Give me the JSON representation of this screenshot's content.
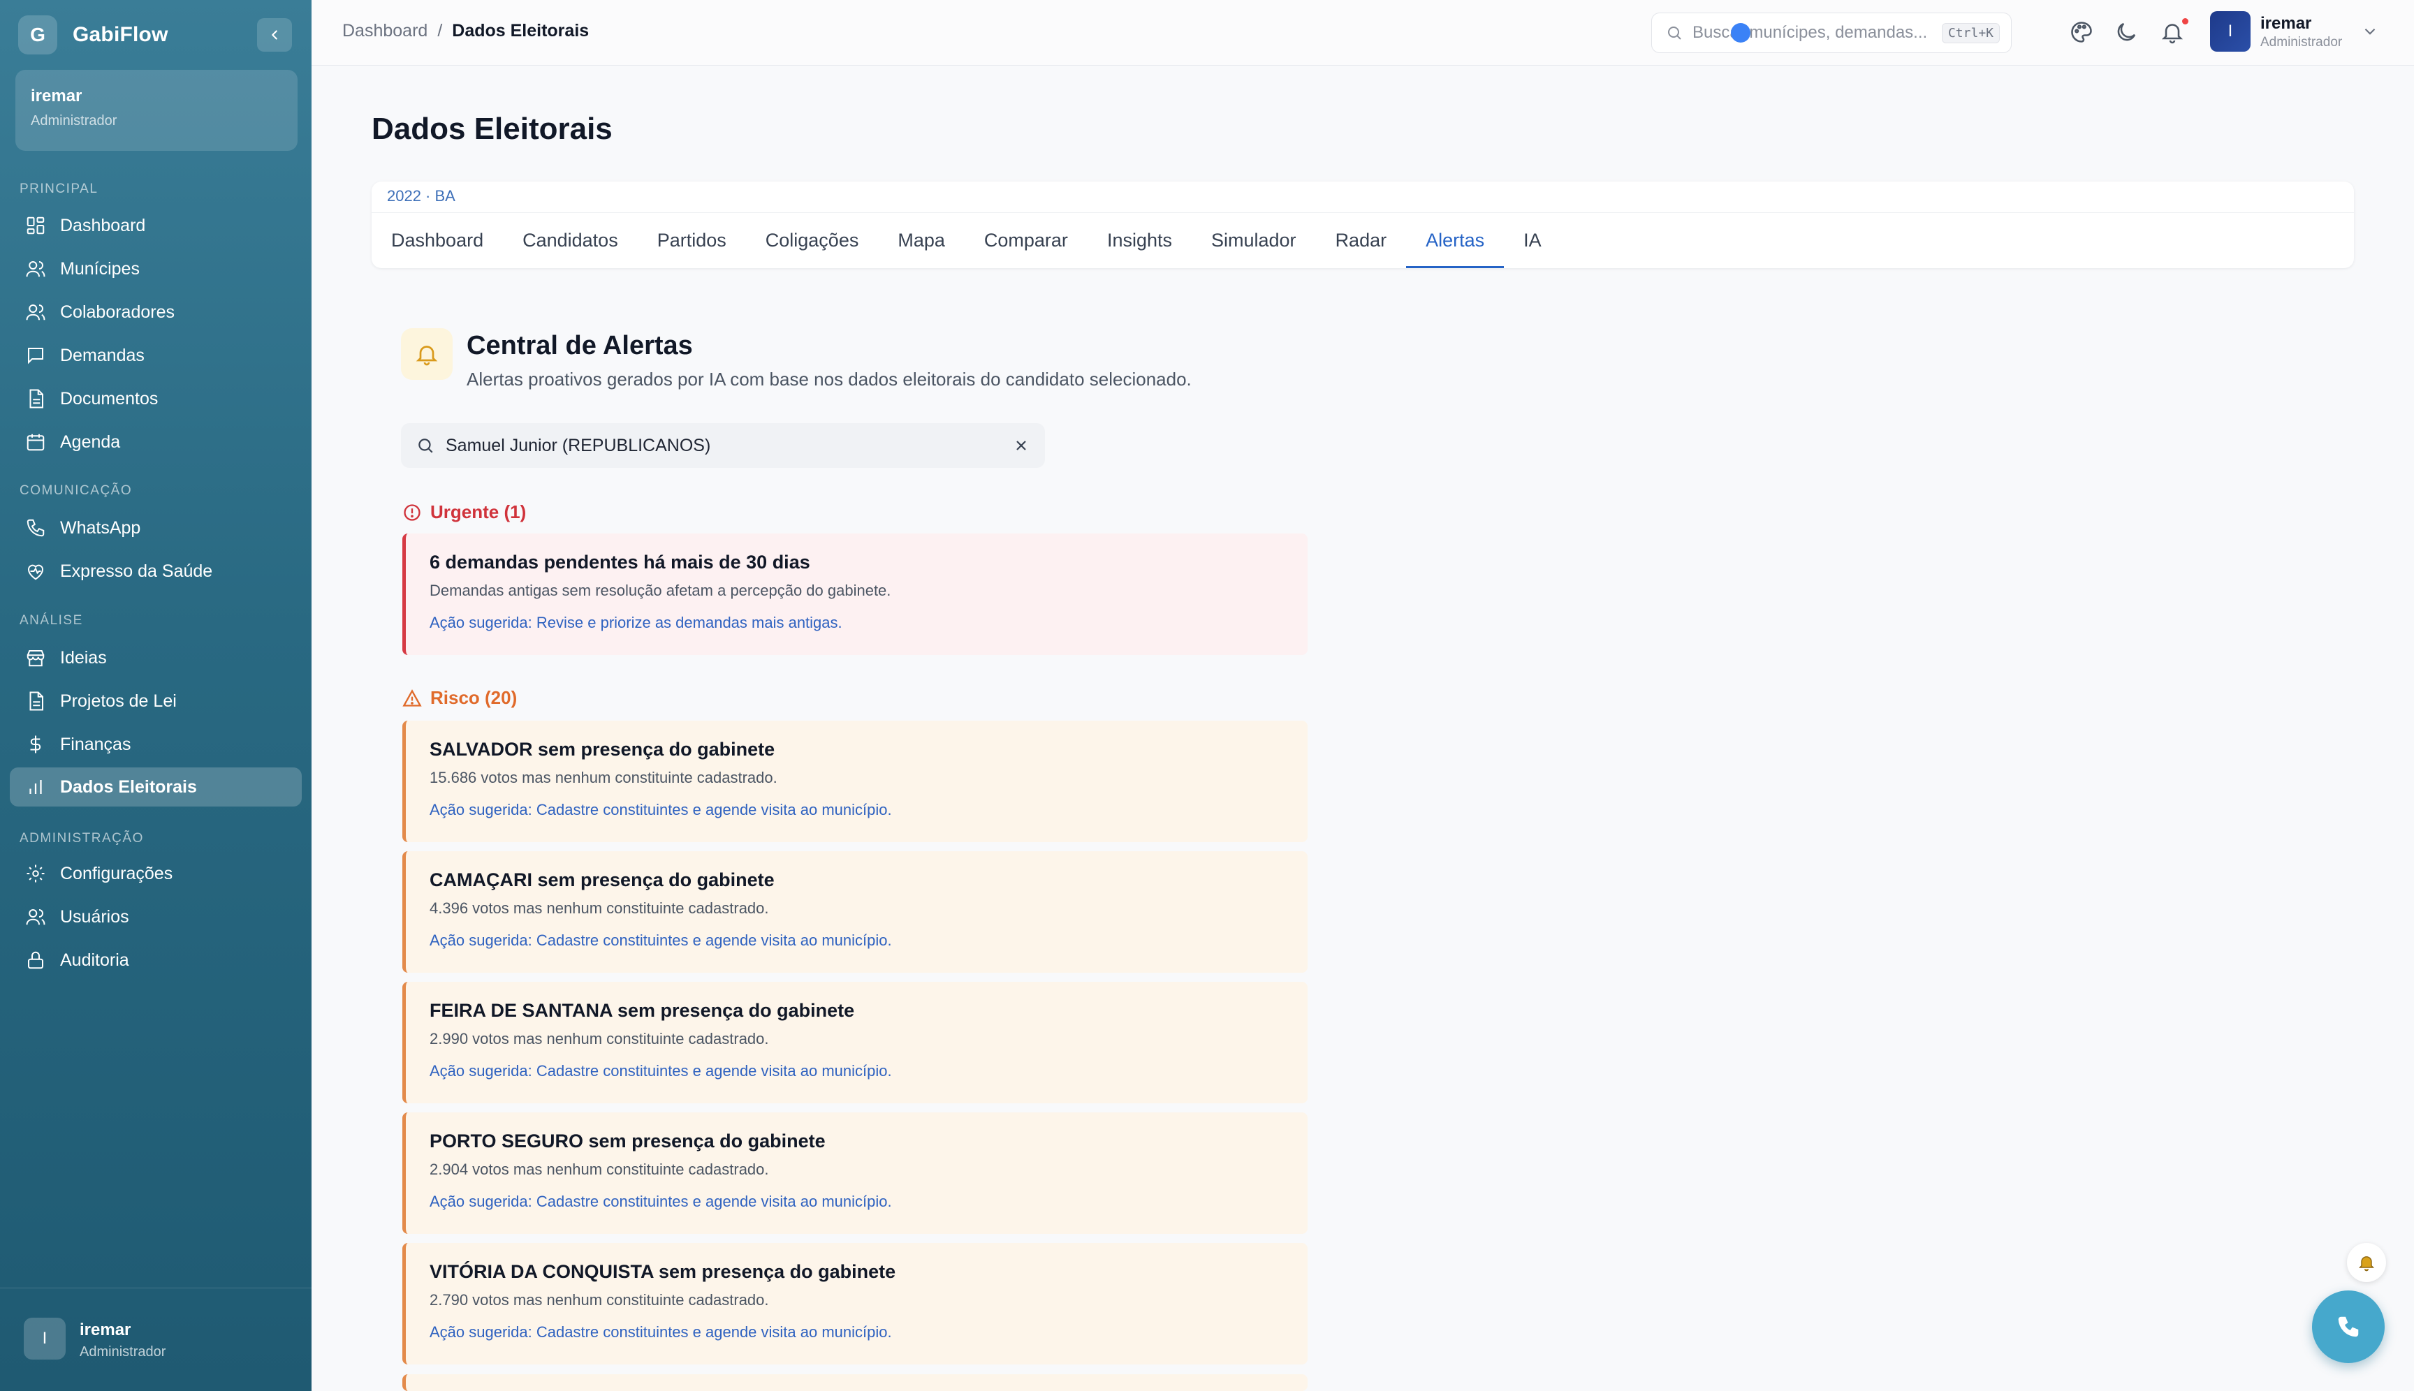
{
  "sidebar": {
    "brand": {
      "initial": "G",
      "name": "GabiFlow"
    },
    "user": {
      "name": "iremar",
      "role": "Administrador"
    },
    "sections": {
      "principal": "PRINCIPAL",
      "comunicacao": "COMUNICAÇÃO",
      "analise": "ANÁLISE",
      "administracao": "ADMINISTRAÇÃO"
    },
    "items": {
      "dashboard": "Dashboard",
      "municipes": "Munícipes",
      "colaboradores": "Colaboradores",
      "demandas": "Demandas",
      "documentos": "Documentos",
      "agenda": "Agenda",
      "whatsapp": "WhatsApp",
      "expresso": "Expresso da Saúde",
      "ideias": "Ideias",
      "projetos": "Projetos de Lei",
      "financas": "Finanças",
      "dados": "Dados Eleitorais",
      "configuracoes": "Configurações",
      "usuarios": "Usuários",
      "auditoria": "Auditoria"
    },
    "footer": {
      "initial": "I",
      "name": "iremar",
      "role": "Administrador"
    }
  },
  "topbar": {
    "breadcrumb": {
      "root": "Dashboard",
      "sep": "/",
      "current": "Dados Eleitorais"
    },
    "search": {
      "placeholder": "Buscar munícipes, demandas...",
      "shortcut": "Ctrl+K"
    },
    "user": {
      "initial": "I",
      "name": "iremar",
      "role": "Administrador"
    }
  },
  "page": {
    "title": "Dados Eleitorais"
  },
  "tabs_card": {
    "context": "2022 · BA",
    "tabs": [
      "Dashboard",
      "Candidatos",
      "Partidos",
      "Coligações",
      "Mapa",
      "Comparar",
      "Insights",
      "Simulador",
      "Radar",
      "Alertas",
      "IA"
    ],
    "active": "Alertas"
  },
  "alerts_header": {
    "title": "Central de Alertas",
    "subtitle": "Alertas proativos gerados por IA com base nos dados eleitorais do candidato selecionado."
  },
  "candidate_search": {
    "value": "Samuel Junior (REPUBLICANOS)"
  },
  "groups": {
    "urgent": {
      "label": "Urgente (1)",
      "alerts": [
        {
          "title": "6 demandas pendentes há mais de 30 dias",
          "desc": "Demandas antigas sem resolução afetam a percepção do gabinete.",
          "action": "Ação sugerida: Revise e priorize as demandas mais antigas."
        }
      ]
    },
    "risk": {
      "label": "Risco (20)",
      "alerts": [
        {
          "title": "SALVADOR sem presença do gabinete",
          "desc": "15.686 votos mas nenhum constituinte cadastrado.",
          "action": "Ação sugerida: Cadastre constituintes e agende visita ao município."
        },
        {
          "title": "CAMAÇARI sem presença do gabinete",
          "desc": "4.396 votos mas nenhum constituinte cadastrado.",
          "action": "Ação sugerida: Cadastre constituintes e agende visita ao município."
        },
        {
          "title": "FEIRA DE SANTANA sem presença do gabinete",
          "desc": "2.990 votos mas nenhum constituinte cadastrado.",
          "action": "Ação sugerida: Cadastre constituintes e agende visita ao município."
        },
        {
          "title": "PORTO SEGURO sem presença do gabinete",
          "desc": "2.904 votos mas nenhum constituinte cadastrado.",
          "action": "Ação sugerida: Cadastre constituintes e agende visita ao município."
        },
        {
          "title": "VITÓRIA DA CONQUISTA sem presença do gabinete",
          "desc": "2.790 votos mas nenhum constituinte cadastrado.",
          "action": "Ação sugerida: Cadastre constituintes e agende visita ao município."
        }
      ]
    }
  },
  "colors": {
    "sidebar": "#2a6b84",
    "accent": "#2563c6",
    "urgent": "#d63a44",
    "risk": "#e38a4a",
    "fab": "#46a8cc"
  },
  "icons": {
    "bell": "bell-icon",
    "search": "search-icon",
    "close": "close-icon",
    "palette": "palette-icon",
    "moon": "moon-icon",
    "phone": "phone-icon",
    "alert_circle": "alert-circle-icon",
    "warning": "warning-triangle-icon"
  }
}
